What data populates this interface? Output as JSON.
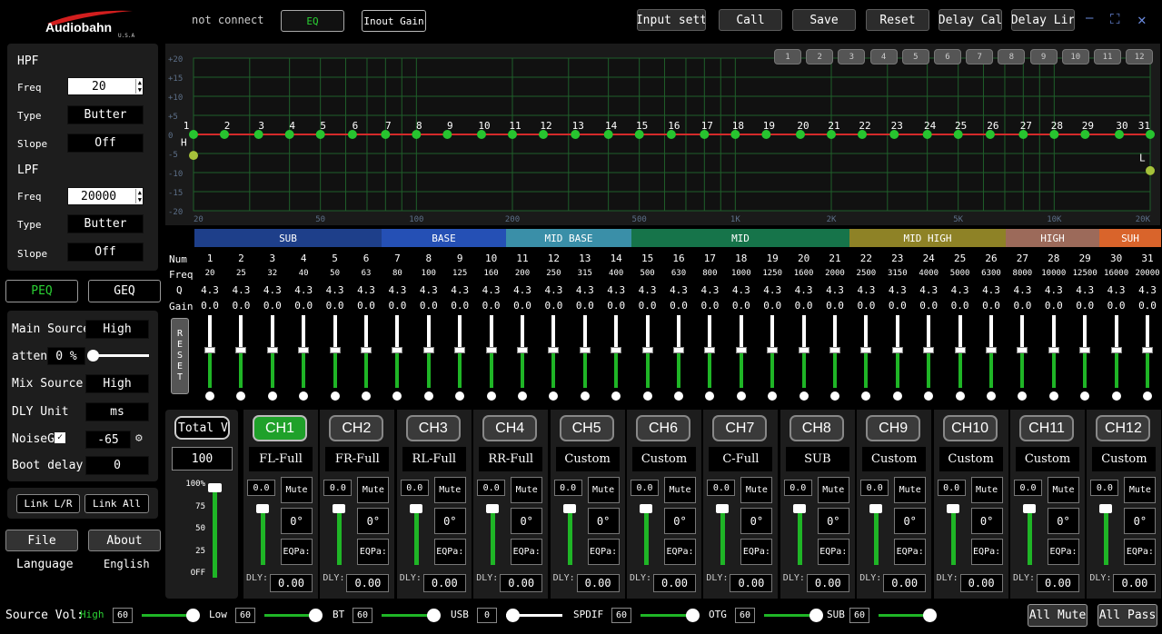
{
  "brand": {
    "name": "Audiobahn",
    "sub": "U.S.A"
  },
  "status": "not connect",
  "tabs": {
    "eq": "EQ",
    "input_gain": "Inout Gain"
  },
  "toolbar": {
    "input_sett": "Input sett",
    "call": "Call",
    "save": "Save",
    "reset": "Reset",
    "delay_cal": "Delay Cal",
    "delay_lir": "Delay Lir"
  },
  "window": {
    "minimize": "—",
    "maximize": "⛶",
    "close": "✕"
  },
  "preset_buttons": [
    "1",
    "2",
    "3",
    "4",
    "5",
    "6",
    "7",
    "8",
    "9",
    "10",
    "11",
    "12"
  ],
  "graph": {
    "y_ticks": [
      "+20",
      "+15",
      "+10",
      "+5",
      "0",
      "-5",
      "-10",
      "-15",
      "-20"
    ],
    "x_ticks": [
      "20",
      "50",
      "100",
      "200",
      "500",
      "1K",
      "2K",
      "5K",
      "10K",
      "20K"
    ],
    "hpf_marker": "H",
    "lpf_marker": "L"
  },
  "hpf": {
    "title": "HPF",
    "freq_label": "Freq",
    "freq": "20",
    "type_label": "Type",
    "type": "Butter",
    "slope_label": "Slope",
    "slope": "Off"
  },
  "lpf": {
    "title": "LPF",
    "freq_label": "Freq",
    "freq": "20000",
    "type_label": "Type",
    "type": "Butter",
    "slope_label": "Slope",
    "slope": "Off"
  },
  "mode": {
    "peq": "PEQ",
    "geq": "GEQ"
  },
  "source": {
    "main_label": "Main Source",
    "main": "High",
    "atten_label": "atten",
    "atten": "0 %",
    "mix_label": "Mix Source",
    "mix": "High",
    "dly_unit_label": "DLY Unit",
    "dly_unit": "ms",
    "noise_label": "NoiseG",
    "noise": "-65",
    "boot_label": "Boot delay",
    "boot": "0"
  },
  "link": {
    "lr": "Link L/R",
    "all": "Link All"
  },
  "file": "File",
  "about": "About",
  "language_label": "Language",
  "language": "English",
  "eq_rows": {
    "num": "Num",
    "freq": "Freq",
    "q": "Q",
    "gain": "Gain"
  },
  "reset_vertical": "RESET",
  "bands": [
    {
      "name": "SUB",
      "color": "#1e3f8a"
    },
    {
      "name": "BASE",
      "color": "#2550b5"
    },
    {
      "name": "MID BASE",
      "color": "#3a8fa8"
    },
    {
      "name": "MID",
      "color": "#16744a"
    },
    {
      "name": "MID HIGH",
      "color": "#8e8226"
    },
    {
      "name": "HIGH",
      "color": "#9c6a5a"
    },
    {
      "name": "SUH",
      "color": "#d9642b"
    }
  ],
  "eq_bands": {
    "nums": [
      "1",
      "2",
      "3",
      "4",
      "5",
      "6",
      "7",
      "8",
      "9",
      "10",
      "11",
      "12",
      "13",
      "14",
      "15",
      "16",
      "17",
      "18",
      "19",
      "20",
      "21",
      "22",
      "23",
      "24",
      "25",
      "26",
      "27",
      "28",
      "29",
      "30",
      "31"
    ],
    "freqs": [
      "20",
      "25",
      "32",
      "40",
      "50",
      "63",
      "80",
      "100",
      "125",
      "160",
      "200",
      "250",
      "315",
      "400",
      "500",
      "630",
      "800",
      "1000",
      "1250",
      "1600",
      "2000",
      "2500",
      "3150",
      "4000",
      "5000",
      "6300",
      "8000",
      "10000",
      "12500",
      "16000",
      "20000"
    ],
    "q": "4.3",
    "gain": "0.0"
  },
  "total_vol": {
    "label": "Total Vo",
    "value": "100",
    "scale": [
      "100%",
      "75",
      "50",
      "25",
      "OFF"
    ],
    "level": 1.0
  },
  "channels": [
    {
      "name": "CH1",
      "mode": "FL-Full",
      "active": true
    },
    {
      "name": "CH2",
      "mode": "FR-Full",
      "active": false
    },
    {
      "name": "CH3",
      "mode": "RL-Full",
      "active": false
    },
    {
      "name": "CH4",
      "mode": "RR-Full",
      "active": false
    },
    {
      "name": "CH5",
      "mode": "Custom",
      "active": false
    },
    {
      "name": "CH6",
      "mode": "Custom",
      "active": false
    },
    {
      "name": "CH7",
      "mode": "C-Full",
      "active": false
    },
    {
      "name": "CH8",
      "mode": "SUB",
      "active": false
    },
    {
      "name": "CH9",
      "mode": "Custom",
      "active": false
    },
    {
      "name": "CH10",
      "mode": "Custom",
      "active": false
    },
    {
      "name": "CH11",
      "mode": "Custom",
      "active": false
    },
    {
      "name": "CH12",
      "mode": "Custom",
      "active": false
    }
  ],
  "channel_common": {
    "value": "0.0",
    "mute": "Mute",
    "phase": "0°",
    "eqp": "EQPa:",
    "dly_label": "DLY:",
    "dly": "0.00"
  },
  "source_vol": {
    "label": "Source Vol:",
    "items": [
      {
        "name": "High",
        "value": "60"
      },
      {
        "name": "Low",
        "value": "60"
      },
      {
        "name": "BT",
        "value": "60"
      },
      {
        "name": "USB",
        "value": "0"
      },
      {
        "name": "SPDIF",
        "value": "60"
      },
      {
        "name": "OTG",
        "value": "60"
      },
      {
        "name": "SUB",
        "value": "60"
      }
    ]
  },
  "all_mute": "All Mute",
  "all_pass": "All Pass",
  "colors": {
    "accent_green": "#1fb526",
    "eq_line": "#d42a2a",
    "node": "#27c42f"
  }
}
